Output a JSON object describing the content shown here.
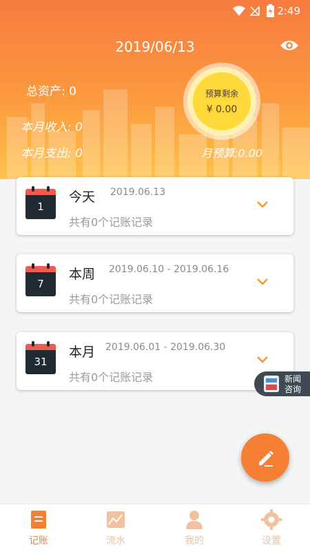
{
  "status": {
    "time": "2:49"
  },
  "header": {
    "date": "2019/06/13",
    "total_assets": "总资产:  0",
    "month_income": "本月收入:  0",
    "month_expense": "本月支出:  0",
    "budget_remaining_label": "预算剩余",
    "budget_remaining_amount": "¥ 0.00",
    "month_budget": "月预算:0.00"
  },
  "cards": [
    {
      "icon_number": "1",
      "name": "今天",
      "range": "2019.06.13",
      "count": "共有0个记账记录"
    },
    {
      "icon_number": "7",
      "name": "本周",
      "range": "2019.06.10 - 2019.06.16",
      "count": "共有0个记账记录"
    },
    {
      "icon_number": "31",
      "name": "本月",
      "range": "2019.06.01 - 2019.06.30",
      "count": "共有0个记账记录"
    }
  ],
  "news_badge": {
    "line1": "新闻",
    "line2": "咨询"
  },
  "tabs": [
    {
      "label": "记账",
      "icon": "ledger-icon",
      "active": true
    },
    {
      "label": "流水",
      "icon": "chart-icon",
      "active": false
    },
    {
      "label": "我的",
      "icon": "person-icon",
      "active": false
    },
    {
      "label": "设置",
      "icon": "gear-icon",
      "active": false
    }
  ],
  "colors": {
    "accent": "#f57f33",
    "inactive": "#f2c29f",
    "header_top": "#f77b3f",
    "header_bottom": "#ffc24a"
  }
}
